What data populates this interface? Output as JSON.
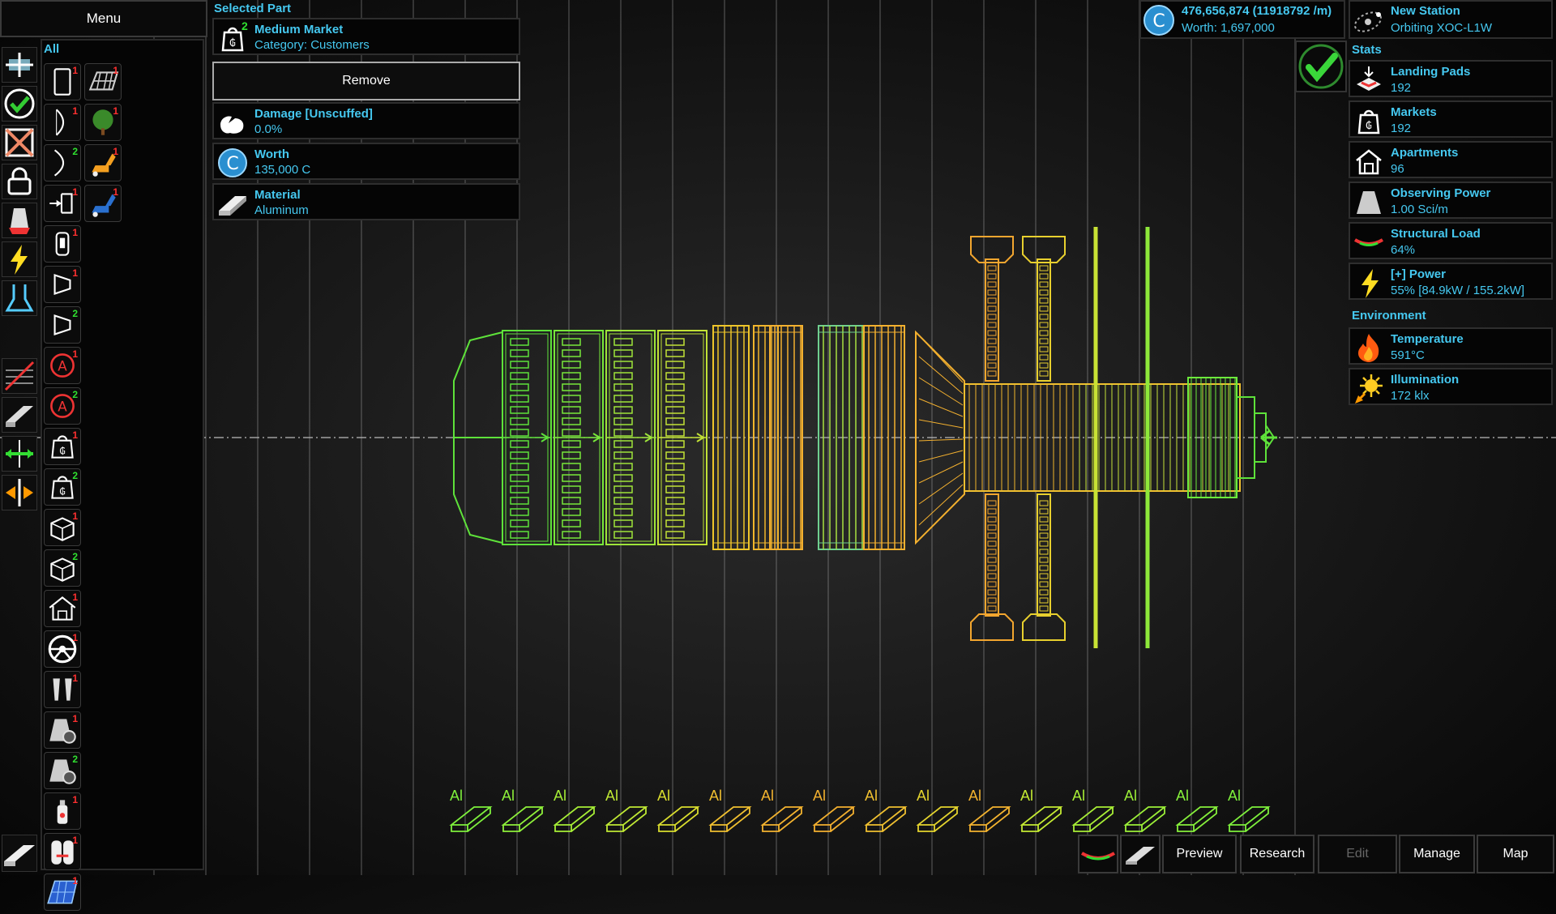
{
  "menu": {
    "label": "Menu"
  },
  "catalog": {
    "filter_label": "All",
    "items": [
      {
        "icon": "door-icon",
        "count": "1",
        "count_color": "red"
      },
      {
        "icon": "solar-grid-icon",
        "count": "1",
        "count_color": "red"
      },
      {
        "icon": "hull-curve-icon",
        "count": "1",
        "count_color": "red"
      },
      {
        "icon": "tree-icon",
        "count": "1",
        "count_color": "red"
      },
      {
        "icon": "hull-arc-icon",
        "count": "2",
        "count_color": "green"
      },
      {
        "icon": "excavator-icon",
        "count": "1",
        "count_color": "red"
      },
      {
        "icon": "docking-port-icon",
        "count": "1",
        "count_color": "red"
      },
      {
        "icon": "crane-icon",
        "count": "1",
        "count_color": "red"
      },
      {
        "icon": "capsule-icon",
        "count": "1",
        "count_color": "red"
      },
      {
        "icon": "nozzle-icon",
        "count": "1",
        "count_color": "red"
      },
      {
        "icon": "nozzle-icon",
        "count": "2",
        "count_color": "green"
      },
      {
        "icon": "warning-module-icon",
        "count": "1",
        "count_color": "red"
      },
      {
        "icon": "warning-module-icon",
        "count": "2",
        "count_color": "green"
      },
      {
        "icon": "market-icon",
        "count": "1",
        "count_color": "red"
      },
      {
        "icon": "market-icon",
        "count": "2",
        "count_color": "green"
      },
      {
        "icon": "cargo-box-icon",
        "count": "1",
        "count_color": "red"
      },
      {
        "icon": "cargo-box-icon",
        "count": "2",
        "count_color": "green"
      },
      {
        "icon": "apartment-icon",
        "count": "1",
        "count_color": "red"
      },
      {
        "icon": "steering-wheel-icon",
        "count": "1",
        "count_color": "red"
      },
      {
        "icon": "thruster-pair-icon",
        "count": "1",
        "count_color": "red"
      },
      {
        "icon": "observatory-gear-icon",
        "count": "1",
        "count_color": "red"
      },
      {
        "icon": "observatory-gear-icon",
        "count": "2",
        "count_color": "green"
      },
      {
        "icon": "tank-icon",
        "count": "1",
        "count_color": "red"
      },
      {
        "icon": "battery-pair-icon",
        "count": "1",
        "count_color": "red"
      },
      {
        "icon": "solar-panel-icon",
        "count": "1",
        "count_color": "red"
      }
    ]
  },
  "selected_part": {
    "header": "Selected Part",
    "name": "Medium Market",
    "count": "2",
    "category": "Category: Customers",
    "remove_label": "Remove",
    "damage_label": "Damage [Unscuffed]",
    "damage_value": "0.0%",
    "worth_label": "Worth",
    "worth_value": "135,000 C",
    "material_label": "Material",
    "material_value": "Aluminum"
  },
  "credits": {
    "balance": "476,656,874 (11918792 /m)",
    "worth": "Worth: 1,697,000",
    "icon_letter": "C"
  },
  "station": {
    "name": "New Station",
    "orbit": "Orbiting XOC-L1W"
  },
  "stats": {
    "header": "Stats",
    "rows": [
      {
        "icon": "landing-pad-icon",
        "label": "Landing Pads",
        "value": "192"
      },
      {
        "icon": "market-icon",
        "label": "Markets",
        "value": "192"
      },
      {
        "icon": "apartment-icon",
        "label": "Apartments",
        "value": "96"
      },
      {
        "icon": "observatory-icon",
        "label": "Observing Power",
        "value": "1.00 Sci/m"
      },
      {
        "icon": "structural-load-icon",
        "label": "Structural Load",
        "value": "64%"
      },
      {
        "icon": "lightning-icon",
        "label": "[+] Power",
        "value": "55% [84.9kW / 155.2kW]"
      }
    ]
  },
  "environment": {
    "header": "Environment",
    "rows": [
      {
        "icon": "fire-icon",
        "label": "Temperature",
        "value": "591°C"
      },
      {
        "icon": "sun-icon",
        "label": "Illumination",
        "value": "172 klx"
      }
    ]
  },
  "materials_strip": {
    "label": "Al",
    "count": 16,
    "colors": [
      "#7ef03c",
      "#8ef03a",
      "#a6ee36",
      "#bfe834",
      "#d9dd2e",
      "#f0c030",
      "#f3b32f",
      "#f3b02f",
      "#f0c030",
      "#e4d42e",
      "#f3b32f",
      "#c4ea33",
      "#a8ee36",
      "#9bef38",
      "#86f03b",
      "#7ef03c"
    ]
  },
  "bottom_bar": {
    "preview": "Preview",
    "research": "Research",
    "edit": "Edit",
    "manage": "Manage",
    "map": "Map"
  },
  "colors": {
    "accent_cyan": "#45c8f0",
    "valid_green": "#30e030",
    "warning_red": "#ff3030"
  }
}
